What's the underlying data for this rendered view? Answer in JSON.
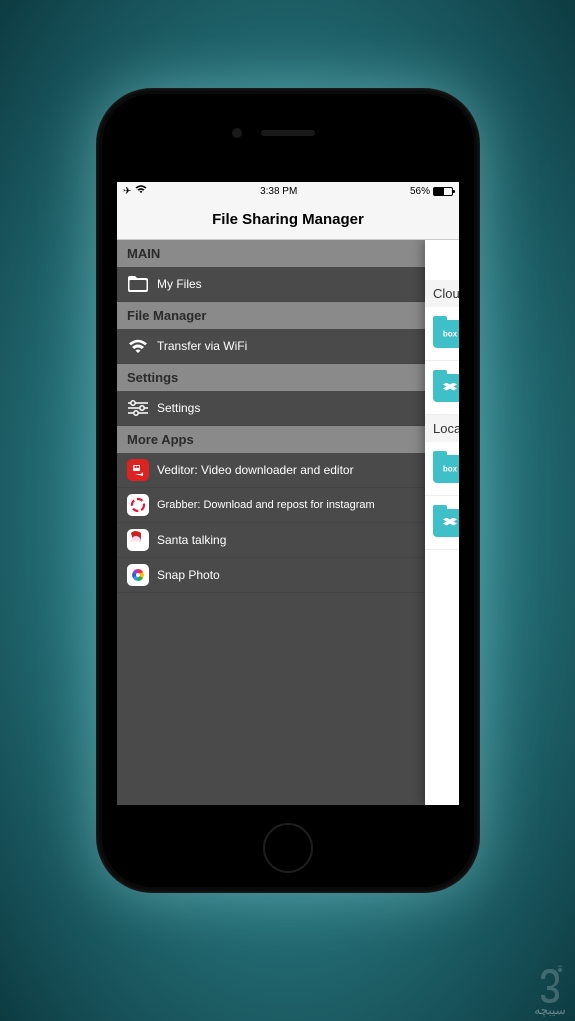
{
  "status": {
    "time": "3:38 PM",
    "battery_pct": "56%"
  },
  "nav": {
    "title": "File Sharing Manager"
  },
  "menu": {
    "sections": {
      "main": "MAIN",
      "file_manager": "File Manager",
      "settings": "Settings",
      "more_apps": "More Apps"
    },
    "items": {
      "my_files": "My Files",
      "transfer_wifi": "Transfer via WiFi",
      "settings": "Settings",
      "veditor": "Veditor: Video downloader and editor",
      "grabber": "Grabber: Download and repost for instagram",
      "santa": "Santa talking",
      "snap": "Snap Photo"
    }
  },
  "main_panel": {
    "section_cloud": "Clou",
    "section_local": "Loca"
  }
}
